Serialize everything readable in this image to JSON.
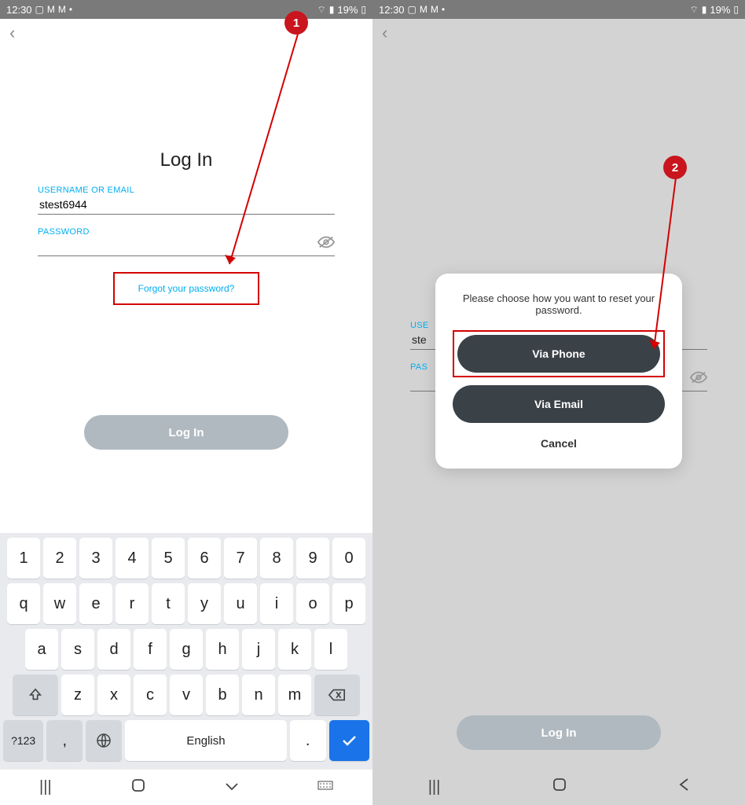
{
  "statusbar": {
    "time": "12:30",
    "battery": "19%"
  },
  "left": {
    "title": "Log In",
    "username_label": "USERNAME OR EMAIL",
    "username_value": "stest6944",
    "password_label": "PASSWORD",
    "forgot": "Forgot your password?",
    "login_btn": "Log In",
    "keyboard": {
      "row1": [
        "1",
        "2",
        "3",
        "4",
        "5",
        "6",
        "7",
        "8",
        "9",
        "0"
      ],
      "row2": [
        "q",
        "w",
        "e",
        "r",
        "t",
        "y",
        "u",
        "i",
        "o",
        "p"
      ],
      "row3": [
        "a",
        "s",
        "d",
        "f",
        "g",
        "h",
        "j",
        "k",
        "l"
      ],
      "row4": [
        "z",
        "x",
        "c",
        "v",
        "b",
        "n",
        "m"
      ],
      "sym": "?123",
      "space": "English"
    }
  },
  "right": {
    "username_label": "USE",
    "username_value": "ste",
    "password_label": "PAS",
    "modal_msg": "Please choose how you want to reset your password.",
    "via_phone": "Via Phone",
    "via_email": "Via Email",
    "cancel": "Cancel",
    "login_btn": "Log In"
  },
  "markers": {
    "one": "1",
    "two": "2"
  }
}
